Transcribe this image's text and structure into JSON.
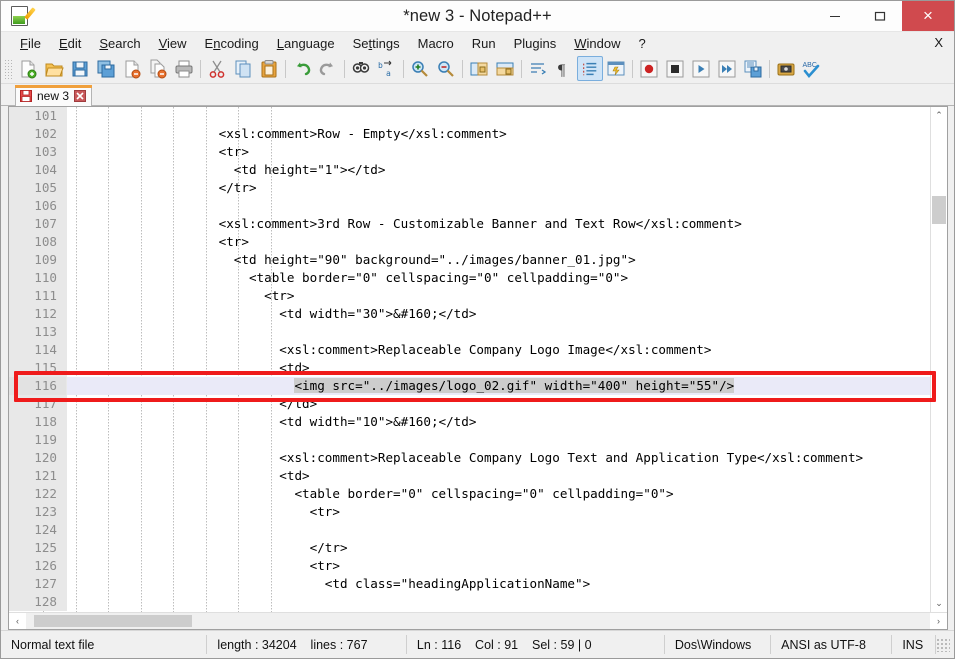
{
  "window": {
    "title": "*new  3 - Notepad++",
    "app_icon": "notepad-plus-plus-icon",
    "minimize_label": "–",
    "maximize_label": "□",
    "close_label": "×",
    "accent_close_color": "#d04a4e"
  },
  "menubar": {
    "items": [
      {
        "label": "File",
        "accel": "F"
      },
      {
        "label": "Edit",
        "accel": "E"
      },
      {
        "label": "Search",
        "accel": "S"
      },
      {
        "label": "View",
        "accel": "V"
      },
      {
        "label": "Encoding",
        "accel": "n"
      },
      {
        "label": "Language",
        "accel": "L"
      },
      {
        "label": "Settings",
        "accel": "t"
      },
      {
        "label": "Macro",
        "accel": "M"
      },
      {
        "label": "Run",
        "accel": "R"
      },
      {
        "label": "Plugins",
        "accel": "P"
      },
      {
        "label": "Window",
        "accel": "W"
      },
      {
        "label": "?",
        "accel": ""
      }
    ],
    "close_document_label": "X"
  },
  "toolbar": {
    "buttons": [
      {
        "name": "new-file-icon",
        "title": "New"
      },
      {
        "name": "open-file-icon",
        "title": "Open"
      },
      {
        "name": "save-icon",
        "title": "Save"
      },
      {
        "name": "save-all-icon",
        "title": "Save All"
      },
      {
        "name": "close-file-icon",
        "title": "Close"
      },
      {
        "name": "close-all-icon",
        "title": "Close All"
      },
      {
        "name": "print-icon",
        "title": "Print"
      },
      {
        "name": "separator",
        "title": ""
      },
      {
        "name": "cut-icon",
        "title": "Cut"
      },
      {
        "name": "copy-icon",
        "title": "Copy"
      },
      {
        "name": "paste-icon",
        "title": "Paste"
      },
      {
        "name": "separator",
        "title": ""
      },
      {
        "name": "undo-icon",
        "title": "Undo"
      },
      {
        "name": "redo-icon",
        "title": "Redo"
      },
      {
        "name": "separator",
        "title": ""
      },
      {
        "name": "find-icon",
        "title": "Find"
      },
      {
        "name": "replace-icon",
        "title": "Replace"
      },
      {
        "name": "separator",
        "title": ""
      },
      {
        "name": "zoom-in-icon",
        "title": "Zoom In"
      },
      {
        "name": "zoom-out-icon",
        "title": "Zoom Out"
      },
      {
        "name": "separator",
        "title": ""
      },
      {
        "name": "sync-vertical-scroll-icon",
        "title": "Synchronize Vertical Scrolling"
      },
      {
        "name": "sync-horizontal-scroll-icon",
        "title": "Synchronize Horizontal Scrolling"
      },
      {
        "name": "separator",
        "title": ""
      },
      {
        "name": "word-wrap-icon",
        "title": "Word wrap"
      },
      {
        "name": "show-all-characters-icon",
        "title": "Show All Characters"
      },
      {
        "name": "indent-guide-icon",
        "title": "Show Indent Guide",
        "active": true
      },
      {
        "name": "user-defined-language-icon",
        "title": "User-Defined Dialogue"
      },
      {
        "name": "separator",
        "title": ""
      },
      {
        "name": "record-macro-icon",
        "title": "Start Recording"
      },
      {
        "name": "stop-macro-icon",
        "title": "Stop Recording"
      },
      {
        "name": "play-macro-icon",
        "title": "Playback"
      },
      {
        "name": "run-macro-multiple-icon",
        "title": "Run a Macro Multiple Times"
      },
      {
        "name": "save-macro-icon",
        "title": "Save Current Recorded Macro"
      },
      {
        "name": "separator",
        "title": ""
      },
      {
        "name": "run-icon",
        "title": "Run"
      },
      {
        "name": "spell-check-icon",
        "title": "Spell Checker"
      }
    ]
  },
  "tabs": [
    {
      "label": "new  3",
      "modified": true,
      "active": true,
      "close_label": "×"
    }
  ],
  "editor": {
    "first_line_number": 101,
    "current_line": 116,
    "selection": {
      "line": 116,
      "text": "<img src=\"../images/logo_02.gif\" width=\"400\" height=\"55\"/>"
    },
    "indent_guide_positions": [
      92,
      125,
      157,
      190,
      222,
      255,
      287,
      320
    ],
    "lines": [
      {
        "n": 101,
        "text": ""
      },
      {
        "n": 102,
        "text": "                    <xsl:comment>Row - Empty</xsl:comment>"
      },
      {
        "n": 103,
        "text": "                    <tr>"
      },
      {
        "n": 104,
        "text": "                      <td height=\"1\"></td>"
      },
      {
        "n": 105,
        "text": "                    </tr>"
      },
      {
        "n": 106,
        "text": ""
      },
      {
        "n": 107,
        "text": "                    <xsl:comment>3rd Row - Customizable Banner and Text Row</xsl:comment>"
      },
      {
        "n": 108,
        "text": "                    <tr>"
      },
      {
        "n": 109,
        "text": "                      <td height=\"90\" background=\"../images/banner_01.jpg\">"
      },
      {
        "n": 110,
        "text": "                        <table border=\"0\" cellspacing=\"0\" cellpadding=\"0\">"
      },
      {
        "n": 111,
        "text": "                          <tr>"
      },
      {
        "n": 112,
        "text": "                            <td width=\"30\">&#160;</td>"
      },
      {
        "n": 113,
        "text": ""
      },
      {
        "n": 114,
        "text": "                            <xsl:comment>Replaceable Company Logo Image</xsl:comment>"
      },
      {
        "n": 115,
        "text": "                            <td>"
      },
      {
        "n": 116,
        "text": "                              <img src=\"../images/logo_02.gif\" width=\"400\" height=\"55\"/>"
      },
      {
        "n": 117,
        "text": "                            </td>"
      },
      {
        "n": 118,
        "text": "                            <td width=\"10\">&#160;</td>"
      },
      {
        "n": 119,
        "text": ""
      },
      {
        "n": 120,
        "text": "                            <xsl:comment>Replaceable Company Logo Text and Application Type</xsl:comment>"
      },
      {
        "n": 121,
        "text": "                            <td>"
      },
      {
        "n": 122,
        "text": "                              <table border=\"0\" cellspacing=\"0\" cellpadding=\"0\">"
      },
      {
        "n": 123,
        "text": "                                <tr>"
      },
      {
        "n": 124,
        "text": ""
      },
      {
        "n": 125,
        "text": "                                </tr>"
      },
      {
        "n": 126,
        "text": "                                <tr>"
      },
      {
        "n": 127,
        "text": "                                  <td class=\"headingApplicationName\">"
      },
      {
        "n": 128,
        "text": ""
      }
    ],
    "vertical_scrollbar": {
      "up_arrow": "⌃",
      "down_arrow": "⌄"
    },
    "horizontal_scrollbar": {
      "left_arrow": "‹",
      "right_arrow": "›"
    }
  },
  "annotation": {
    "color": "#ef1b1b",
    "target": "line-116"
  },
  "statusbar": {
    "file_type": "Normal text file",
    "length_lines": "length : 34204    lines : 767",
    "position": "Ln : 116    Col : 91    Sel : 59 | 0",
    "eol": "Dos\\Windows",
    "encoding": "ANSI as UTF-8",
    "insert_mode": "INS"
  }
}
